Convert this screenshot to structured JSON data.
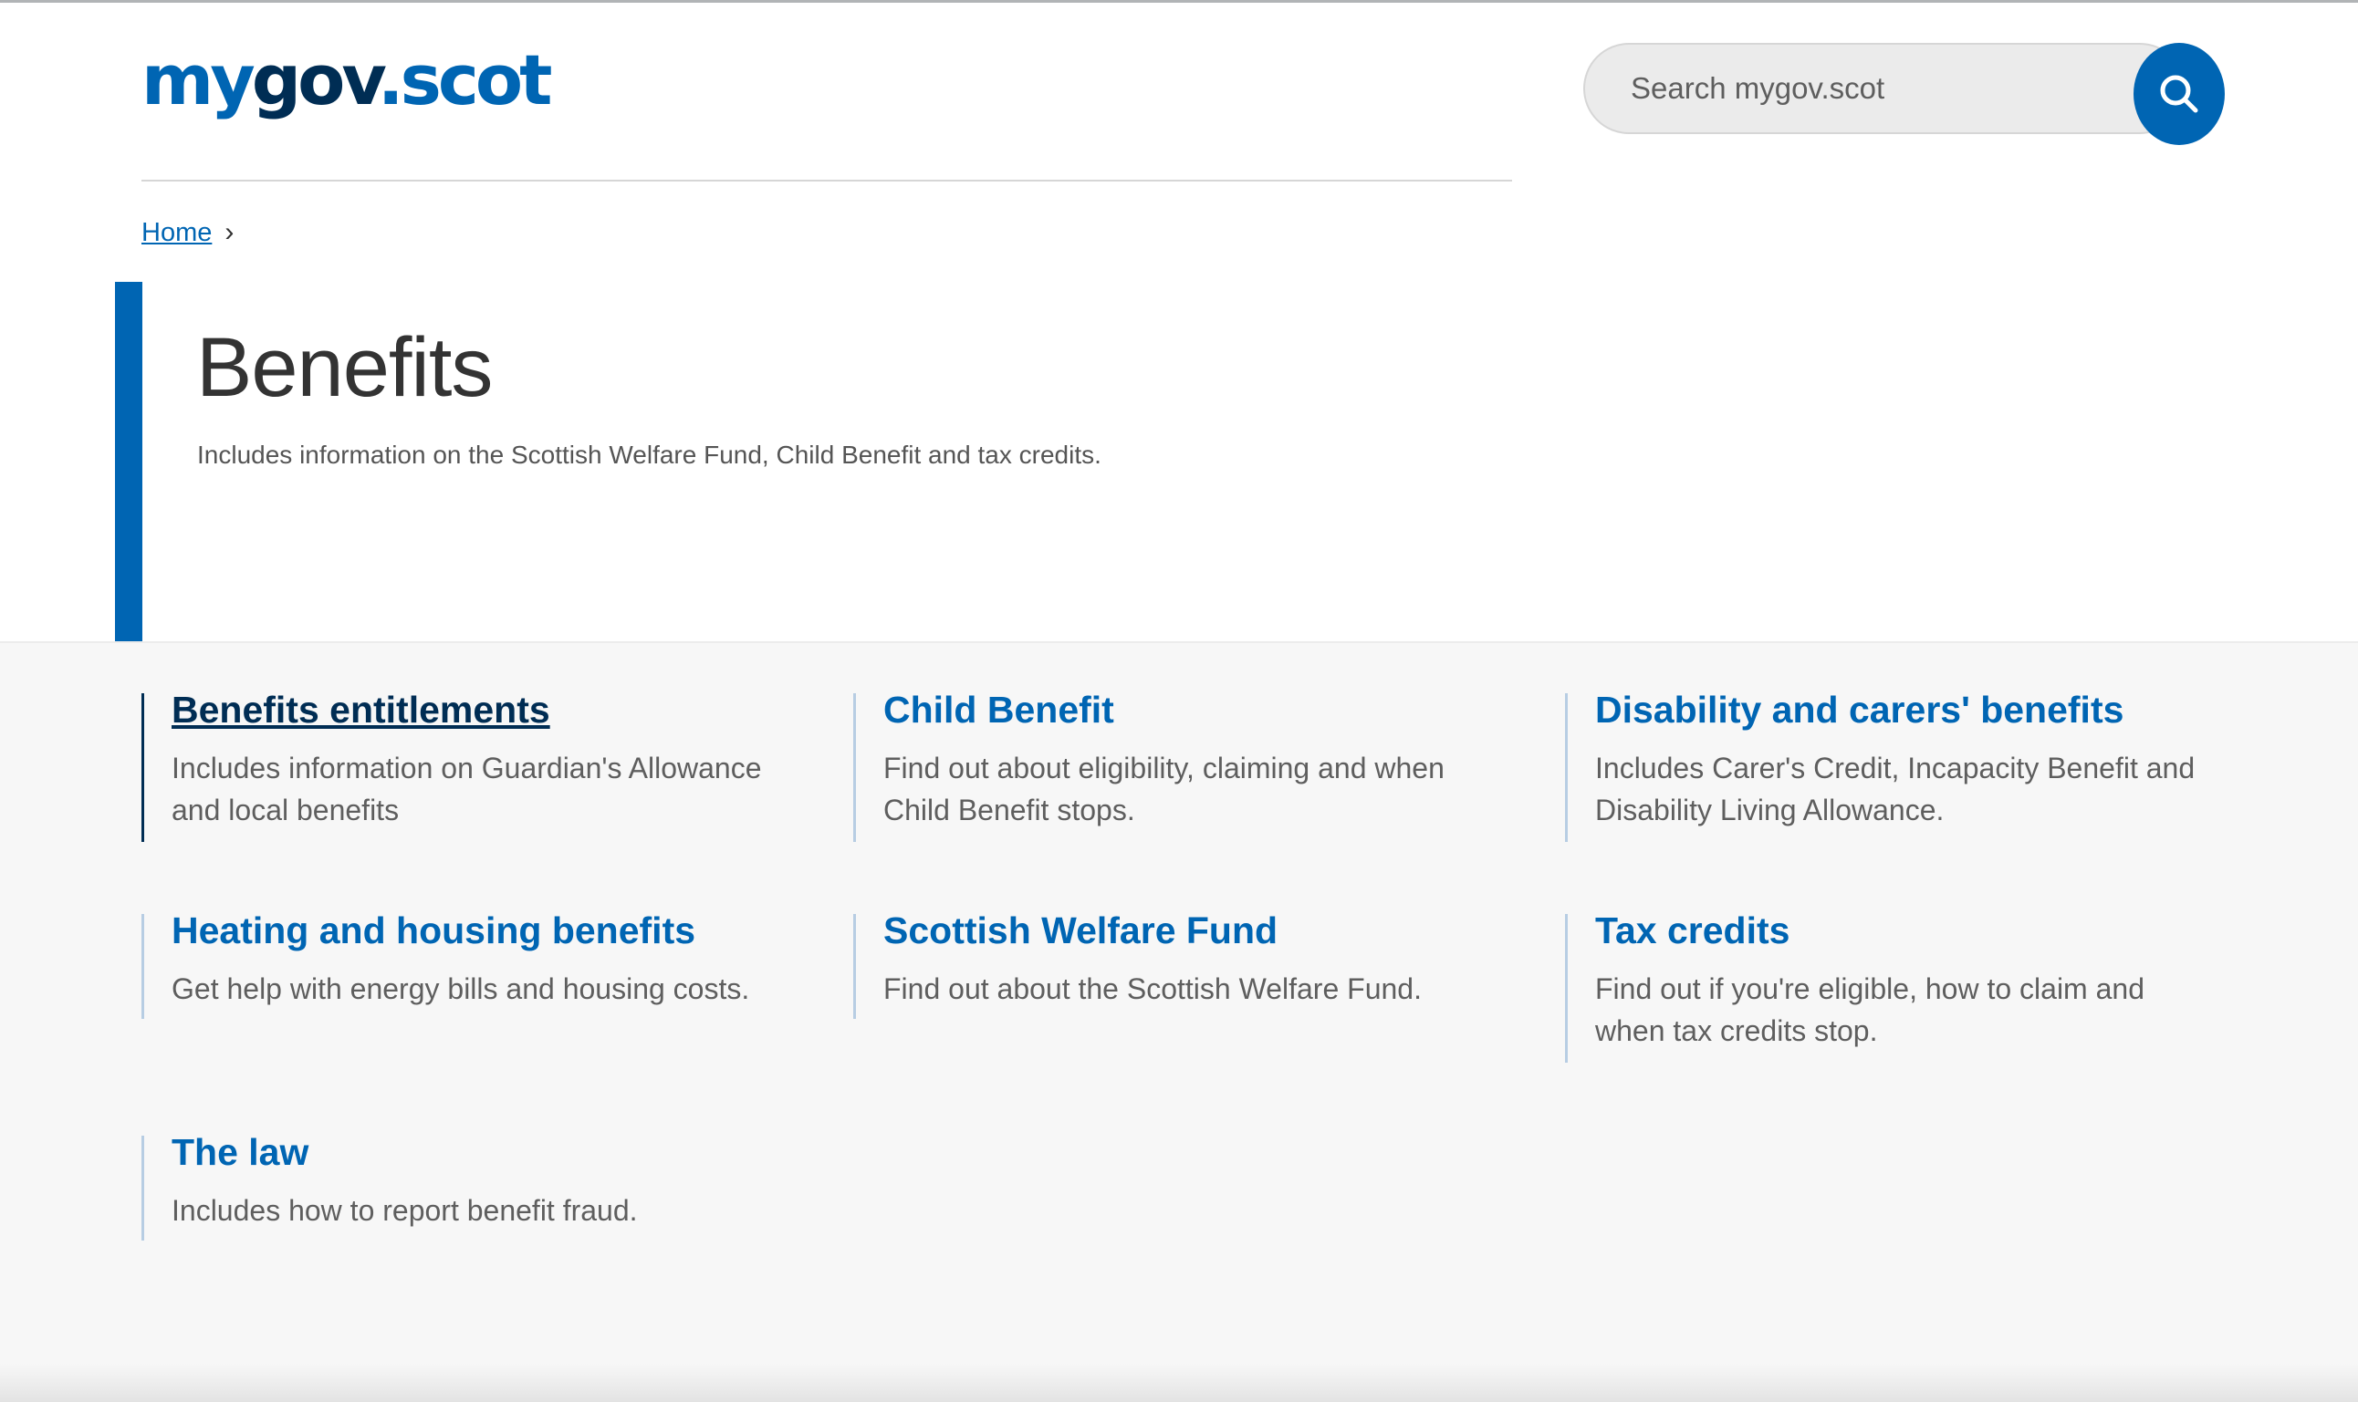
{
  "header": {
    "logo": {
      "my": "my",
      "gov": "gov",
      "dot": ".",
      "scot": "scot"
    },
    "search": {
      "placeholder": "Search mygov.scot",
      "icon": "search-icon"
    }
  },
  "breadcrumb": {
    "items": [
      {
        "label": "Home"
      }
    ],
    "separator": "›"
  },
  "hero": {
    "title": "Benefits",
    "description": "Includes information on the Scottish Welfare Fund, Child Benefit and tax credits."
  },
  "topics": [
    {
      "title": "Benefits entitlements",
      "description": "Includes information on Guardian's Allowance and local benefits",
      "active": true
    },
    {
      "title": "Child Benefit",
      "description": "Find out about eligibility, claiming and when Child Benefit stops."
    },
    {
      "title": "Disability and carers' benefits",
      "description": "Includes Carer's Credit, Incapacity Benefit and Disability Living Allowance."
    },
    {
      "title": "Heating and housing benefits",
      "description": "Get help with energy bills and housing costs."
    },
    {
      "title": "Scottish Welfare Fund",
      "description": "Find out about the Scottish Welfare Fund."
    },
    {
      "title": "Tax credits",
      "description": "Find out if you're eligible, how to claim and when tax credits stop."
    },
    {
      "title": "The law",
      "description": "Includes how to report benefit fraud."
    }
  ],
  "colors": {
    "brand_blue": "#0065b3",
    "brand_dark": "#002d54",
    "text": "#333333",
    "muted": "#5e5e5e",
    "panel_bg": "#f7f7f7"
  }
}
